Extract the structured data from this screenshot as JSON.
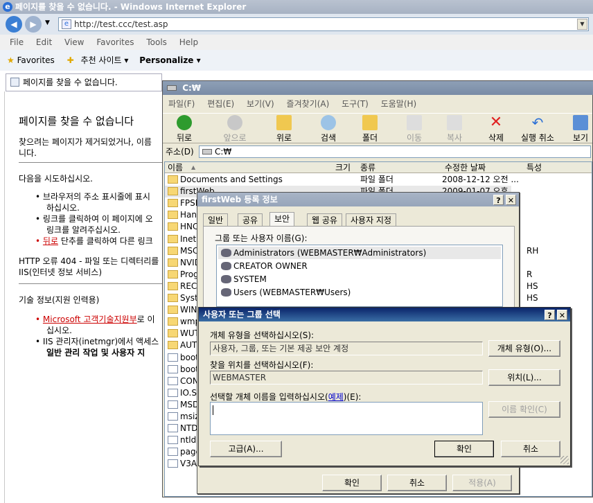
{
  "ie": {
    "title": "페이지를 찾을 수 없습니다. - Windows Internet Explorer",
    "url": "http://test.ccc/test.asp",
    "menu": [
      "File",
      "Edit",
      "View",
      "Favorites",
      "Tools",
      "Help"
    ],
    "favorites_label": "Favorites",
    "fav_item1": "추천 사이트 ▾",
    "fav_item2": "Personalize ▾",
    "tab_label": "페이지를 찾을 수 없습니다.",
    "page": {
      "heading": "페이지를 찾을 수 없습니다",
      "p1": "찾으려는 페이지가 제거되었거나, 이름",
      "p1b": "니다.",
      "try_heading": "다음을 시도하십시오.",
      "b1": "브라우저의 주소 표시줄에 표시",
      "b1b": "하십시오.",
      "b2": "링크를 클릭하여 이 페이지에 오",
      "b2b": "링크를 알려주십시오.",
      "b3_link": "뒤로",
      "b3": " 단추를 클릭하여 다른 링크",
      "http_error": "HTTP 오류 404 - 파일 또는 디렉터리를",
      "iis": "IIS(인터넷 정보 서비스)",
      "tech_heading": "기술 정보(지원 인력용)",
      "t1_link": "Microsoft 고객기술지원부",
      "t1": "로 이",
      "t1b": "십시오.",
      "t2": "IIS 관리자(inetmgr)에서 액세스",
      "t2b": "일반 관리 작업 및 사용자 지"
    }
  },
  "explorer": {
    "title": "C:₩",
    "menu": [
      "파일(F)",
      "편집(E)",
      "보기(V)",
      "즐겨찾기(A)",
      "도구(T)",
      "도움말(H)"
    ],
    "toolbar": [
      "뒤로",
      "앞으로",
      "위로",
      "검색",
      "폴더",
      "이동",
      "복사",
      "삭제",
      "실행 취소",
      "보기"
    ],
    "address_label": "주소(D)",
    "address_value": "C:₩",
    "columns": [
      "이름",
      "크기",
      "종류",
      "수정한 날짜",
      "특성"
    ],
    "files": [
      {
        "name": "Documents and Settings",
        "type": "파일 폴더",
        "date": "2008-12-12 오전 ...",
        "attr": ""
      },
      {
        "name": "firstWeb",
        "type": "파일 폴더",
        "date": "2009-01-07 오후",
        "attr": ""
      },
      {
        "name": "FPSE",
        "type": "",
        "date": "",
        "attr": ""
      },
      {
        "name": "Hand",
        "type": "",
        "date": "",
        "attr": ""
      },
      {
        "name": "HNC",
        "type": "",
        "date": "",
        "attr": ""
      },
      {
        "name": "Inetp",
        "type": "",
        "date": "",
        "attr": ""
      },
      {
        "name": "MSC",
        "type": "",
        "date": "",
        "attr": "RH"
      },
      {
        "name": "NVID",
        "type": "",
        "date": "",
        "attr": ""
      },
      {
        "name": "Prog",
        "type": "",
        "date": "",
        "attr": "R"
      },
      {
        "name": "REC",
        "type": "",
        "date": "",
        "attr": "HS"
      },
      {
        "name": "Syst",
        "type": "",
        "date": "",
        "attr": "HS"
      },
      {
        "name": "WIND",
        "type": "",
        "date": "",
        "attr": ""
      },
      {
        "name": "wmp",
        "type": "",
        "date": "",
        "attr": ""
      },
      {
        "name": "WUT",
        "type": "",
        "date": "",
        "attr": ""
      },
      {
        "name": "AUTO",
        "type": "",
        "date": "",
        "attr": ""
      },
      {
        "name": "boot.",
        "type": "",
        "date": "",
        "attr": ""
      },
      {
        "name": "boot",
        "type": "",
        "date": "",
        "attr": ""
      },
      {
        "name": "CON",
        "type": "",
        "date": "",
        "attr": ""
      },
      {
        "name": "IO.S",
        "type": "",
        "date": "",
        "attr": ""
      },
      {
        "name": "MSD",
        "type": "",
        "date": "",
        "attr": ""
      },
      {
        "name": "msiz",
        "type": "",
        "date": "",
        "attr": ""
      },
      {
        "name": "NTD",
        "type": "",
        "date": "",
        "attr": ""
      },
      {
        "name": "ntldr",
        "type": "",
        "date": "",
        "attr": ""
      },
      {
        "name": "page",
        "type": "",
        "date": "",
        "attr": ""
      },
      {
        "name": "V3A",
        "type": "",
        "date": "",
        "attr": ""
      }
    ]
  },
  "props": {
    "title": "firstWeb 등록 정보",
    "tabs": [
      "일반",
      "공유",
      "보안",
      "웹 공유",
      "사용자 지정"
    ],
    "group_label": "그룹 또는 사용자 이름(G):",
    "users": [
      "Administrators (WEBMASTER₩Administrators)",
      "CREATOR OWNER",
      "SYSTEM",
      "Users (WEBMASTER₩Users)"
    ],
    "ok": "확인",
    "cancel": "취소",
    "apply": "적용(A)"
  },
  "select": {
    "title": "사용자 또는 그룹 선택",
    "type_label": "개체 유형을 선택하십시오(S):",
    "type_value": "사용자, 그룹, 또는 기본 제공 보안 계정",
    "type_button": "개체 유형(O)...",
    "loc_label": "찾을 위치를 선택하십시오(F):",
    "loc_value": "WEBMASTER",
    "loc_button": "위치(L)...",
    "name_label": "선택할 개체 이름을 입력하십시오(",
    "name_link": "예제",
    "name_label_end": ")(E):",
    "check_button": "이름 확인(C)",
    "advanced": "고급(A)...",
    "ok": "확인",
    "cancel": "취소"
  }
}
